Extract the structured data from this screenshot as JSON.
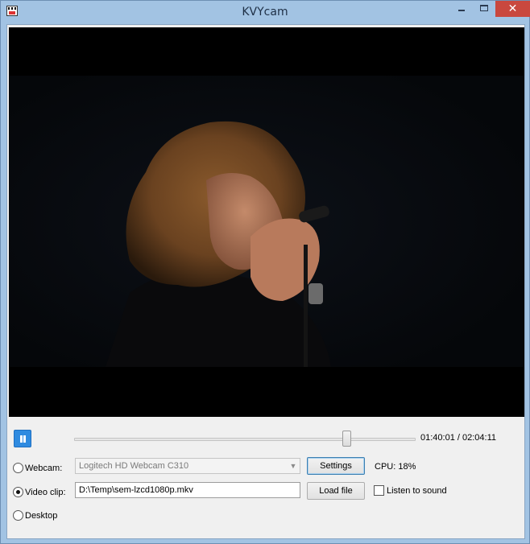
{
  "window": {
    "title": "KVYcam",
    "close_glyph": "✕"
  },
  "icons": {
    "app": "clapperboard-icon",
    "minimize": "minimize-icon",
    "maximize": "maximize-icon",
    "close": "close-icon",
    "pause": "pause-icon",
    "dropdown": "chevron-down-icon"
  },
  "player": {
    "time": "01:40:01 / 02:04:11",
    "position_fraction": 0.797
  },
  "sources": {
    "webcam_label": "Webcam:",
    "webcam_device": "Logitech HD Webcam C310",
    "video_clip_label": "Video clip:",
    "video_clip_path": "D:\\Temp\\sem-lzcd1080p.mkv",
    "desktop_label": "Desktop",
    "selected": "video_clip"
  },
  "buttons": {
    "settings": "Settings",
    "load_file": "Load file"
  },
  "status": {
    "cpu": "CPU: 18%"
  },
  "options": {
    "listen_to_sound_label": "Listen to sound",
    "listen_to_sound_checked": false
  },
  "colors": {
    "accent": "#2f8be0",
    "close": "#c9483e",
    "titlebar": "#a2c3e3"
  }
}
